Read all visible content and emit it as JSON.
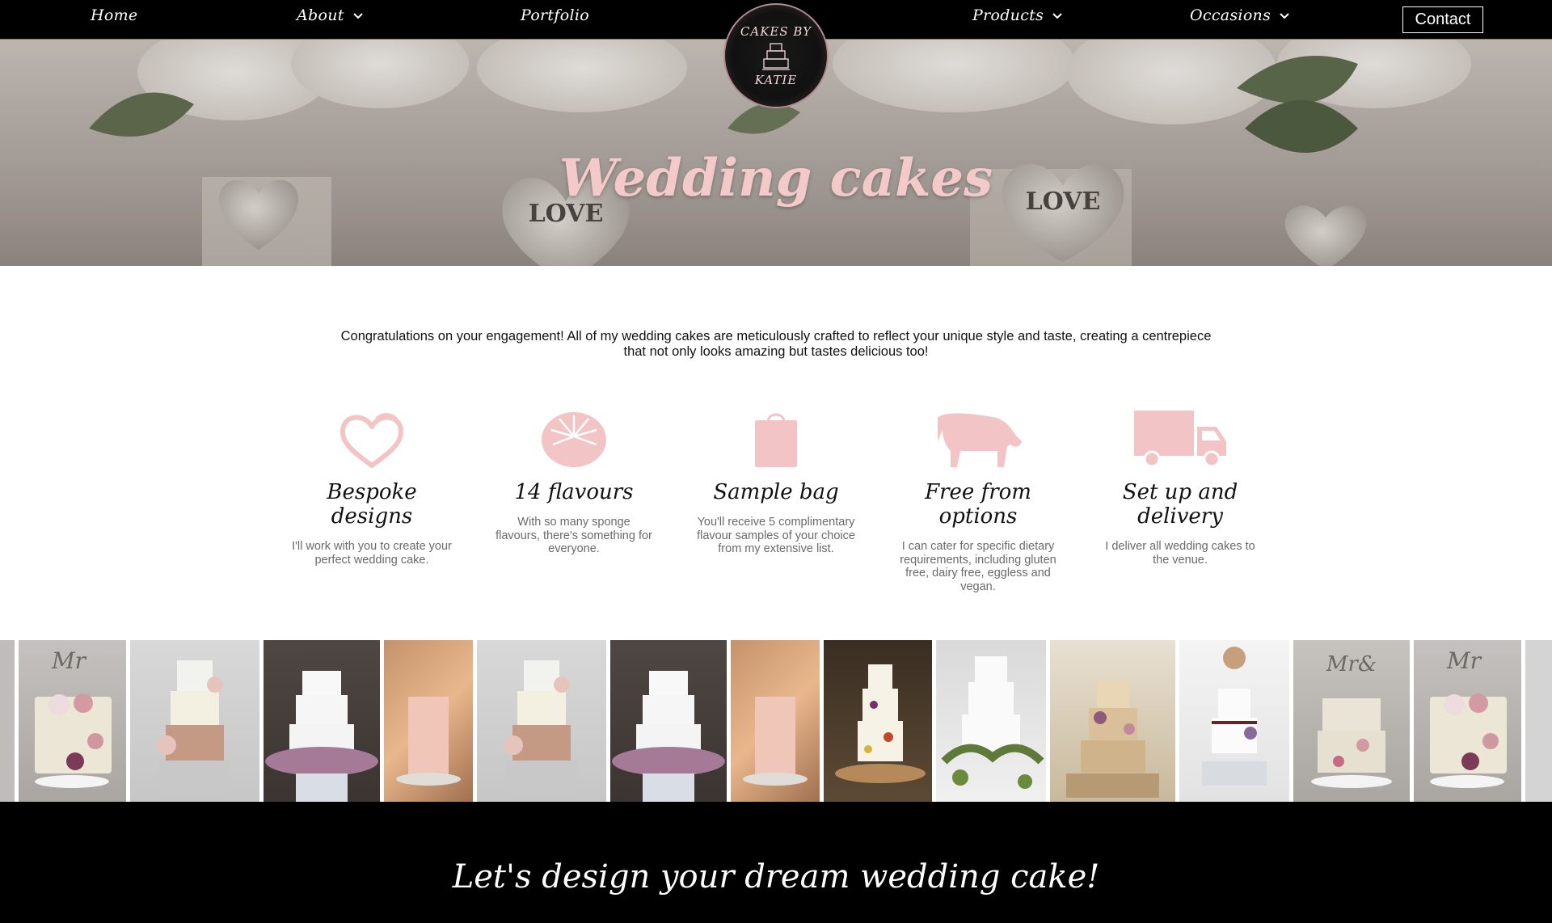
{
  "nav": {
    "items": [
      {
        "label": "Home"
      },
      {
        "label": "About"
      },
      {
        "label": "Portfolio"
      },
      {
        "label": "Products"
      },
      {
        "label": "Occasions"
      }
    ],
    "contact_label": "Contact",
    "logo_line1": "CAKES BY",
    "logo_line2": "KATIE"
  },
  "hero": {
    "title": "Wedding cakes",
    "heart_text_1": "LOVE",
    "heart_text_2": "LOVE"
  },
  "intro": {
    "text": "Congratulations on your engagement! All of my wedding cakes are meticulously crafted to reflect your unique style and taste, creating a centrepiece that not only looks amazing but tastes delicious too!"
  },
  "features": [
    {
      "icon": "heart-icon",
      "title": "Bespoke designs",
      "desc": "I'll work with you to create your perfect wedding cake."
    },
    {
      "icon": "flavour-egg-icon",
      "title": "14 flavours",
      "desc": "With so many sponge flavours, there's something for everyone."
    },
    {
      "icon": "shopping-bag-icon",
      "title": "Sample bag",
      "desc": "You'll receive 5 complimentary flavour samples of your choice from my extensive list."
    },
    {
      "icon": "cow-icon",
      "title": "Free from options",
      "desc": "I can cater for specific dietary requirements, including gluten free, dairy free, eggless and vegan."
    },
    {
      "icon": "delivery-truck-icon",
      "title": "Set up and delivery",
      "desc": "I deliver all wedding cakes to the venue."
    }
  ],
  "colors": {
    "accent_pink": "#f3c4c6",
    "nav_bg": "#000000",
    "desc_text": "#6a6a6a"
  },
  "cta": {
    "title": "Let's design your dream wedding cake!"
  }
}
